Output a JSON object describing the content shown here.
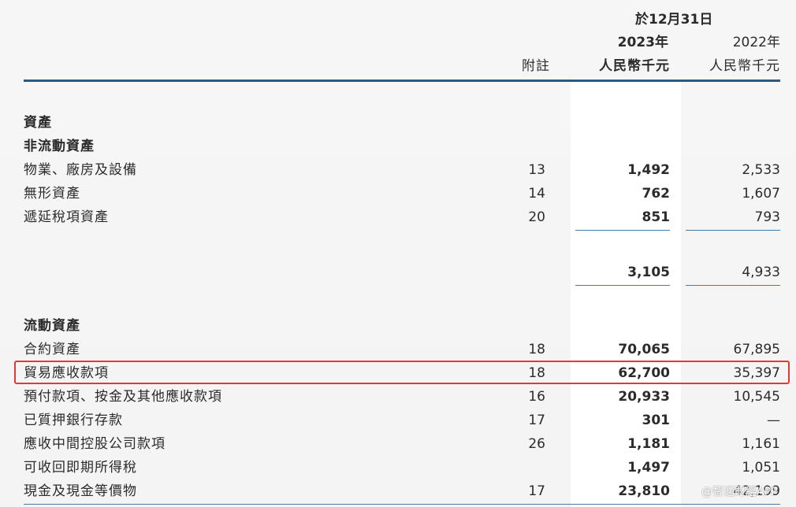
{
  "header": {
    "date_label": "於12月31日",
    "year_current": "2023年",
    "year_prior": "2022年",
    "note_col": "附註",
    "unit_current": "人民幣千元",
    "unit_prior": "人民幣千元"
  },
  "section_assets": "資產",
  "noncurrent": {
    "title": "非流動資產",
    "rows": [
      {
        "label": "物業、廠房及設備",
        "note": "13",
        "current": "1,492",
        "prior": "2,533"
      },
      {
        "label": "無形資產",
        "note": "14",
        "current": "762",
        "prior": "1,607"
      },
      {
        "label": "遞延稅項資產",
        "note": "20",
        "current": "851",
        "prior": "793"
      }
    ],
    "total_current": "3,105",
    "total_prior": "4,933"
  },
  "current_assets": {
    "title": "流動資產",
    "rows": [
      {
        "label": "合約資產",
        "note": "18",
        "current": "70,065",
        "prior": "67,895"
      },
      {
        "label": "貿易應收款項",
        "note": "18",
        "current": "62,700",
        "prior": "35,397"
      },
      {
        "label": "預付款項、按金及其他應收款項",
        "note": "16",
        "current": "20,933",
        "prior": "10,545"
      },
      {
        "label": "已質押銀行存款",
        "note": "17",
        "current": "301",
        "prior": "—"
      },
      {
        "label": "應收中間控股公司款項",
        "note": "26",
        "current": "1,181",
        "prior": "1,161"
      },
      {
        "label": "可收回即期所得稅",
        "note": "",
        "current": "1,497",
        "prior": "1,051"
      },
      {
        "label": "現金及現金等價物",
        "note": "17",
        "current": "23,810",
        "prior": "42,199"
      }
    ]
  },
  "watermark": "@智通財經APP",
  "colors": {
    "rule": "#2a5a82",
    "highlight": "#e23a33"
  }
}
